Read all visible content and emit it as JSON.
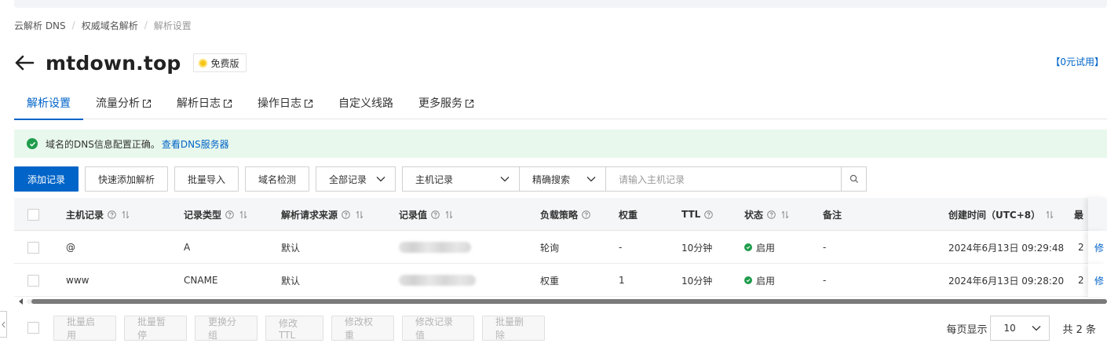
{
  "breadcrumb": [
    "云解析 DNS",
    "权威域名解析",
    "解析设置"
  ],
  "header": {
    "title": "mtdown.top",
    "badge": "免费版",
    "trial_link": "【0元试用】"
  },
  "tabs": [
    {
      "label": "解析设置",
      "active": true,
      "external": false
    },
    {
      "label": "流量分析",
      "active": false,
      "external": true
    },
    {
      "label": "解析日志",
      "active": false,
      "external": true
    },
    {
      "label": "操作日志",
      "active": false,
      "external": true
    },
    {
      "label": "自定义线路",
      "active": false,
      "external": false
    },
    {
      "label": "更多服务",
      "active": false,
      "external": true
    }
  ],
  "alert": {
    "text": "域名的DNS信息配置正确。",
    "link": "查看DNS服务器"
  },
  "toolbar": {
    "add": "添加记录",
    "quick_add": "快速添加解析",
    "import": "批量导入",
    "check": "域名检测",
    "filter_select": "全部记录",
    "field_select": "主机记录",
    "mode_select": "精确搜索",
    "search_placeholder": "请输入主机记录"
  },
  "table": {
    "headers": {
      "host": "主机记录",
      "type": "记录类型",
      "line": "解析请求来源",
      "value": "记录值",
      "policy": "负载策略",
      "weight": "权重",
      "ttl": "TTL",
      "status": "状态",
      "remark": "备注",
      "created": "创建时间（UTC+8）",
      "edge": "最"
    },
    "rows": [
      {
        "host": "@",
        "type": "A",
        "line": "默认",
        "policy": "轮询",
        "weight": "-",
        "ttl": "10分钟",
        "status": "启用",
        "remark": "-",
        "created": "2024年6月13日 09:29:48",
        "updated": "2",
        "op": "修"
      },
      {
        "host": "www",
        "type": "CNAME",
        "line": "默认",
        "policy": "权重",
        "weight": "1",
        "ttl": "10分钟",
        "status": "启用",
        "remark": "-",
        "created": "2024年6月13日 09:28:20",
        "updated": "2",
        "op": "修"
      }
    ]
  },
  "bulk_actions": [
    "批量启用",
    "批量暂停",
    "更换分组",
    "修改TTL",
    "修改权重",
    "修改记录值",
    "批量删除"
  ],
  "pager": {
    "per_page_label": "每页显示",
    "per_page": "10",
    "total": "共 2 条"
  },
  "colors": {
    "accent": "#0064c8",
    "success": "#1f9c4b",
    "alert_bg": "#e8f8ec"
  }
}
